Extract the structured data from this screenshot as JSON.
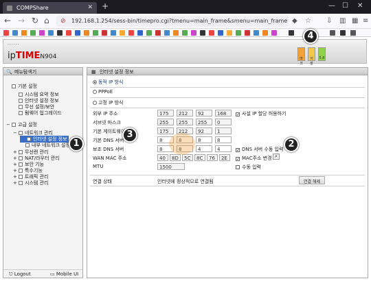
{
  "browser": {
    "tab_title": "COMPShare",
    "tab_close": "✕",
    "new_tab": "+",
    "url": "192.168.1.254/sess-bin/timepro.cgi?tmenu=main_frame&smenu=main_frame",
    "colors": {
      "tabbar": "#1c1b22",
      "toolbar": "#f9f9fb"
    }
  },
  "header": {
    "logo_dots": "······",
    "brand_prefix": "ip",
    "brand_main": "TIME",
    "brand_model": "N904",
    "buttons": [
      {
        "label": "마크",
        "color": "#f2a23a"
      },
      {
        "label": "저장",
        "color": "#f2c84a"
      },
      {
        "label": "5.8",
        "color": "#8fd24a"
      }
    ]
  },
  "left_panel": {
    "title": "메뉴탐색기",
    "tree": [
      {
        "label": "기본 설정",
        "level": 0,
        "toggle": "",
        "selected": false
      },
      {
        "label": "시스템 요약 정보",
        "level": 1,
        "toggle": "",
        "selected": false
      },
      {
        "label": "인터넷 설정 정보",
        "level": 1,
        "toggle": "",
        "selected": false
      },
      {
        "label": "무선 설정/보안",
        "level": 1,
        "toggle": "",
        "selected": false
      },
      {
        "label": "펌웨어 업그레이드",
        "level": 1,
        "toggle": "",
        "selected": false
      },
      {
        "label": "고급 설정",
        "level": 0,
        "toggle": "−",
        "selected": false
      },
      {
        "label": "네트워크 관리",
        "level": 1,
        "toggle": "−",
        "selected": false
      },
      {
        "label": "인터넷 설정 정보",
        "level": 2,
        "toggle": "",
        "selected": true
      },
      {
        "label": "내부 네트워크 설정",
        "level": 2,
        "toggle": "",
        "selected": false
      },
      {
        "label": "무선랜 관리",
        "level": 1,
        "toggle": "+",
        "selected": false
      },
      {
        "label": "NAT/라우터 관리",
        "level": 1,
        "toggle": "+",
        "selected": false
      },
      {
        "label": "보안 기능",
        "level": 1,
        "toggle": "+",
        "selected": false
      },
      {
        "label": "특수기능",
        "level": 1,
        "toggle": "+",
        "selected": false
      },
      {
        "label": "트래픽 관리",
        "level": 1,
        "toggle": "+",
        "selected": false
      },
      {
        "label": "시스템 관리",
        "level": 1,
        "toggle": "+",
        "selected": false
      }
    ],
    "logout": "Logout",
    "mobile": "Mobile UI"
  },
  "right_panel": {
    "title": "인터넷 설정 정보",
    "modes": [
      {
        "label": "동적 IP 방식",
        "checked": true
      },
      {
        "label": "PPPoE",
        "checked": false
      },
      {
        "label": "고정 IP 방식",
        "checked": false
      }
    ],
    "fields": [
      {
        "label": "외부 IP 주소",
        "values": [
          "175",
          "212",
          "92",
          "168"
        ]
      },
      {
        "label": "서브넷 마스크",
        "values": [
          "255",
          "255",
          "255",
          "0"
        ]
      },
      {
        "label": "기본 게이트웨이",
        "values": [
          "175",
          "212",
          "92",
          "1"
        ]
      },
      {
        "label": "기본 DNS 서버",
        "values": [
          "8",
          "8",
          "8",
          "8"
        ]
      },
      {
        "label": "보조 DNS 서버",
        "values": [
          "8",
          "8",
          "4",
          "4"
        ]
      }
    ],
    "wan_mac_label": "WAN MAC 주소",
    "wan_mac_values": [
      "40",
      "8D",
      "5C",
      "8C",
      "76",
      "2E"
    ],
    "mtu_label": "MTU",
    "mtu_value": "1500",
    "checks": {
      "private_ip": "사설 IP 할당 허용하기",
      "dns_manual": "DNS 서버 수동 입력",
      "mac_change": "MAC주소 변경",
      "manual_input": "수동 입력"
    },
    "status_label": "연결 상태",
    "status_text": "인터넷에 정상적으로 연결됨",
    "disconnect_button": "연결 해제"
  },
  "markers": [
    "1",
    "2",
    "3",
    "4"
  ]
}
